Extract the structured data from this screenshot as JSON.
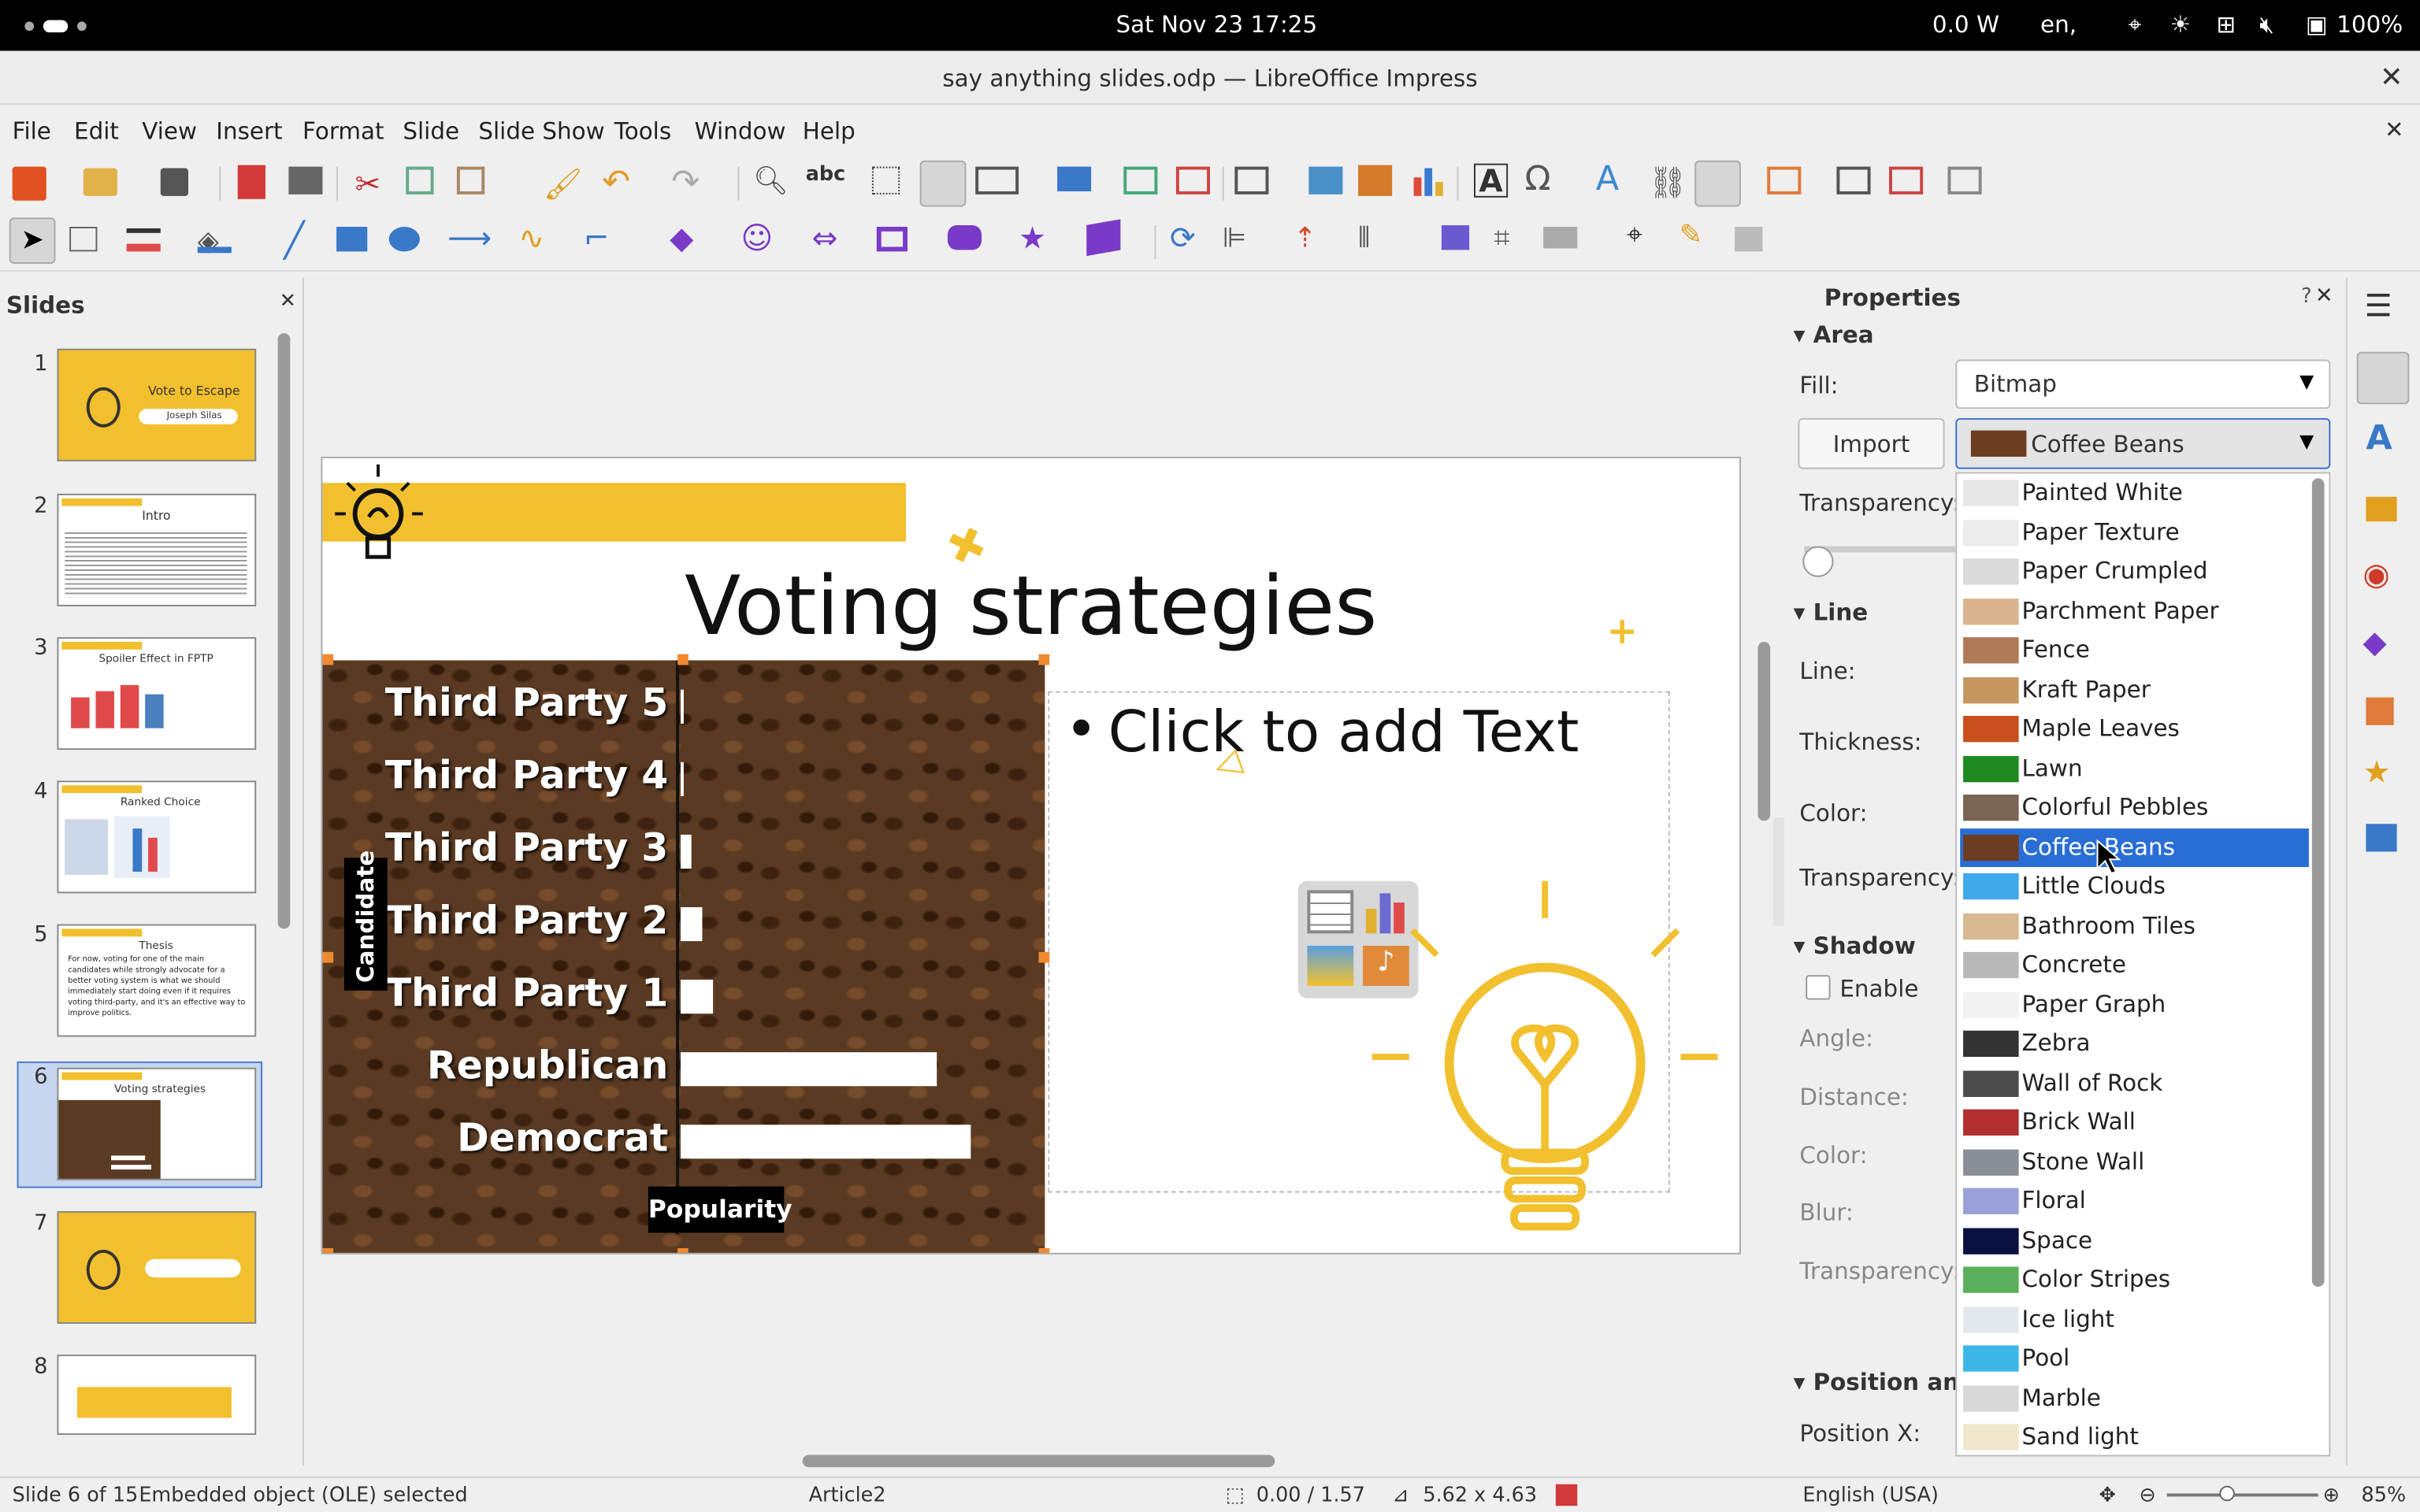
{
  "system_bar": {
    "datetime": "Sat Nov 23  17:25",
    "power": "0.0 W",
    "lang": "en,",
    "battery": "100%"
  },
  "window": {
    "title": "say anything slides.odp — LibreOffice Impress"
  },
  "menu": [
    "File",
    "Edit",
    "View",
    "Insert",
    "Format",
    "Slide",
    "Slide Show",
    "Tools",
    "Window",
    "Help"
  ],
  "slides_panel": {
    "title": "Slides",
    "thumbs": [
      {
        "num": "1",
        "title": "Vote to Escape",
        "sub": "Joseph Silas"
      },
      {
        "num": "2",
        "title": "Intro"
      },
      {
        "num": "3",
        "title": "Spoiler Effect in FPTP"
      },
      {
        "num": "4",
        "title": "Ranked Choice"
      },
      {
        "num": "5",
        "title": "Thesis",
        "body": "For now, voting for one of the main candidates while strongly advocate for a better voting system is what we should immediately start doing even if it requires voting third-party, and it's an effective way to improve politics."
      },
      {
        "num": "6",
        "title": "Voting strategies"
      },
      {
        "num": "7"
      },
      {
        "num": "8"
      }
    ]
  },
  "slide": {
    "title": "Voting strategies",
    "placeholder": "Click to add Text",
    "chart": {
      "y_axis_label": "Candidate",
      "x_axis_label": "Popularity"
    }
  },
  "chart_data": {
    "type": "bar",
    "orientation": "horizontal",
    "categories": [
      "Third Party 5",
      "Third Party 4",
      "Third Party 3",
      "Third Party 2",
      "Third Party 1",
      "Republican",
      "Democrat"
    ],
    "values": [
      0.5,
      0.5,
      2,
      4,
      6,
      47,
      53
    ],
    "xlabel": "Popularity",
    "ylabel": "Candidate",
    "xlim": [
      0,
      65
    ]
  },
  "properties": {
    "title": "Properties",
    "area": {
      "heading": "Area",
      "fill_label": "Fill:",
      "fill_value": "Bitmap",
      "import_label": "Import",
      "bitmap_value": "Coffee Beans",
      "transparency_label": "Transparency:"
    },
    "line": {
      "heading": "Line",
      "line_label": "Line:",
      "thickness_label": "Thickness:",
      "color_label": "Color:",
      "transparency_label": "Transparency:"
    },
    "shadow": {
      "heading": "Shadow",
      "enable_label": "Enable",
      "angle_label": "Angle:",
      "distance_label": "Distance:",
      "color_label": "Color:",
      "blur_label": "Blur:",
      "transparency_label": "Transparency:"
    },
    "position": {
      "heading": "Position and",
      "posx_label": "Position X:"
    }
  },
  "bitmap_list": [
    {
      "name": "Painted White",
      "color": "#e6e6e6"
    },
    {
      "name": "Paper Texture",
      "color": "#ececec"
    },
    {
      "name": "Paper Crumpled",
      "color": "#dadada"
    },
    {
      "name": "Parchment Paper",
      "color": "#d9b48f"
    },
    {
      "name": "Fence",
      "color": "#b07a58"
    },
    {
      "name": "Kraft Paper",
      "color": "#c5975f"
    },
    {
      "name": "Maple Leaves",
      "color": "#c8501e"
    },
    {
      "name": "Lawn",
      "color": "#1f8a1f"
    },
    {
      "name": "Colorful Pebbles",
      "color": "#7b6454"
    },
    {
      "name": "Coffee Beans",
      "color": "#6b3e22"
    },
    {
      "name": "Little Clouds",
      "color": "#3fa8e8"
    },
    {
      "name": "Bathroom Tiles",
      "color": "#d8b890"
    },
    {
      "name": "Concrete",
      "color": "#b8b8b8"
    },
    {
      "name": "Paper Graph",
      "color": "#f2f2f2"
    },
    {
      "name": "Zebra",
      "color": "#333333"
    },
    {
      "name": "Wall of Rock",
      "color": "#4c4c4c"
    },
    {
      "name": "Brick Wall",
      "color": "#b03030"
    },
    {
      "name": "Stone Wall",
      "color": "#8a8e96"
    },
    {
      "name": "Floral",
      "color": "#9aa0d8"
    },
    {
      "name": "Space",
      "color": "#0a1040"
    },
    {
      "name": "Color Stripes",
      "color": "#5ab05a"
    },
    {
      "name": "Ice light",
      "color": "#e2e8ee"
    },
    {
      "name": "Pool",
      "color": "#3cb6e6"
    },
    {
      "name": "Marble",
      "color": "#d8d8d8"
    },
    {
      "name": "Sand light",
      "color": "#efe6cc"
    }
  ],
  "selected_bitmap": "Coffee Beans",
  "status": {
    "slide": "Slide 6 of 15",
    "selection": "Embedded object (OLE) selected",
    "layout": "Article2",
    "position": "0.00 / 1.57",
    "size": "5.62 x 4.63",
    "language": "English (USA)",
    "zoom": "85%"
  },
  "colors": {
    "accent": "#f2c02e",
    "selection": "#2a6ed5",
    "coffee": "#5a3a22"
  }
}
